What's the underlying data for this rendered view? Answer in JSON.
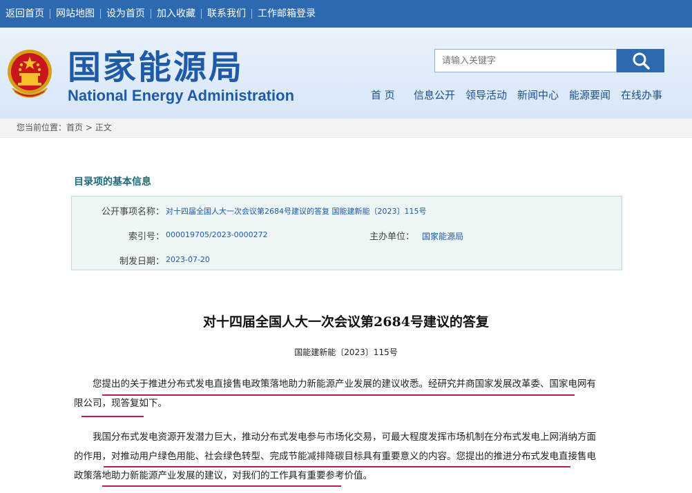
{
  "topbar": {
    "links": [
      "返回首页",
      "网站地图",
      "设为首页",
      "加入收藏",
      "联系我们",
      "工作邮箱登录"
    ]
  },
  "header": {
    "brand_cn": "国家能源局",
    "brand_en": "National Energy Administration",
    "search_placeholder": "请输入关键字",
    "nav": [
      "首 页",
      "信息公开",
      "领导活动",
      "新闻中心",
      "能源要闻",
      "在线办事"
    ]
  },
  "breadcrumb": {
    "prefix": "您当前位置：",
    "home": "首页",
    "separator": ">",
    "current": "正文"
  },
  "info": {
    "section_title": "目录项的基本信息",
    "public_item_label": "公开事项名称：",
    "public_item_value": "对十四届全国人大一次会议第2684号建议的答复 国能建新能〔2023〕115号",
    "index_label": "索引号：",
    "index_value": "000019705/2023-0000272",
    "host_label": "主办单位：",
    "host_value": "国家能源局",
    "date_label": "制发日期：",
    "date_value": "2023-07-20"
  },
  "document": {
    "title": "对十四届全国人大一次会议第2684号建议的答复",
    "number": "国能建新能〔2023〕115号",
    "para1_line1": "您提出的关于推进分布式发电直接售电政策落地助力新能源产业发展的建议收悉。经研究并商国家发展改革委、国家电网有",
    "para1_line2": "限公司，现答复如下。",
    "para2_line1": "我国分布式发电资源开发潜力巨大，推动分布式发电参与市场化交易，可最大程度发挥市场机制在分布式发电上网消纳方面",
    "para2_line2": "的作用，对推动用户绿色用能、社会绿色转型、完成节能减排降碳目标具有重要意义的内容。您提出的推进分布式发电直接售电",
    "para2_line3": "政策落地助力新能源产业发展的建议，对我们的工作具有重要参考价值。"
  },
  "colors": {
    "topbar": "#2c69b0",
    "brand": "#1e5aa8",
    "underline": "#c2185b"
  }
}
